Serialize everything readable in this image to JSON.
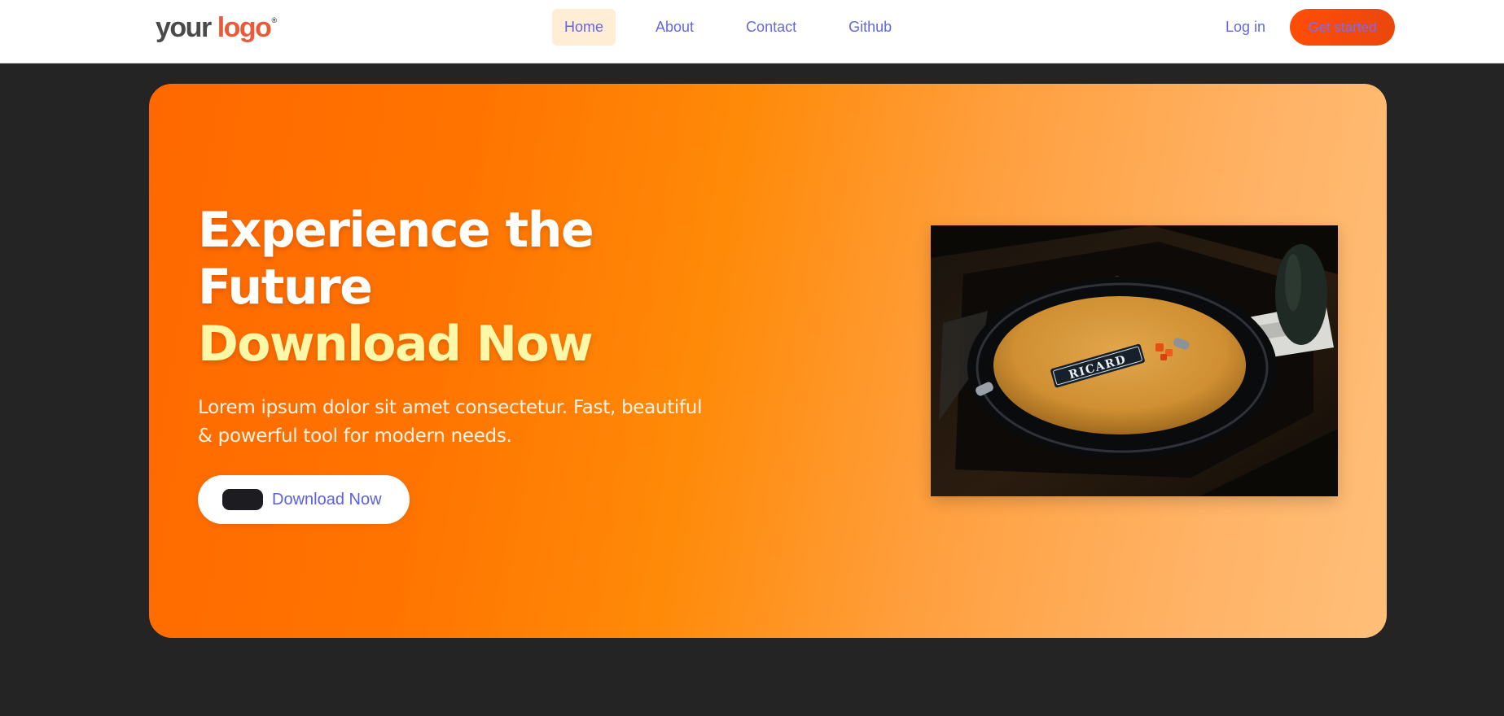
{
  "header": {
    "logo": {
      "word1": "your",
      "word2": "logo",
      "mark": "®"
    },
    "nav": [
      {
        "label": "Home",
        "active": true
      },
      {
        "label": "About",
        "active": false
      },
      {
        "label": "Contact",
        "active": false
      },
      {
        "label": "Github",
        "active": false
      }
    ],
    "login_label": "Log in",
    "cta_label": "Get started"
  },
  "hero": {
    "title_line1": "Experience the",
    "title_line2": "Future",
    "title_accent": "Download Now",
    "description": "Lorem ipsum dolor sit amet consectetur. Fast, beautiful & powerful tool for modern needs.",
    "button": {
      "label": "Download Now",
      "icon": "app-store-badge-icon"
    },
    "image": {
      "subject": "ashtray-photo",
      "brand_text": "RICARD"
    }
  },
  "colors": {
    "background": "#242424",
    "accent": "#ff6800",
    "nav_text": "#6468e0",
    "accent_text": "#fdf7a8"
  }
}
